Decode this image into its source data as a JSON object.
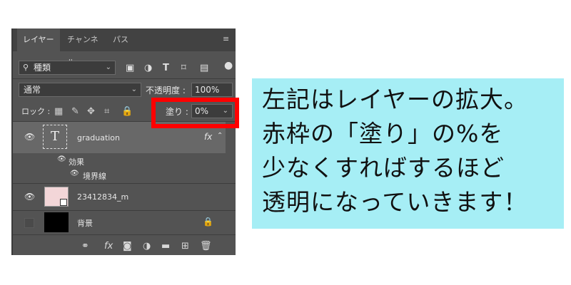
{
  "tabs": [
    {
      "label": "レイヤー",
      "active": true
    },
    {
      "label": "チャンネル",
      "active": false
    },
    {
      "label": "パス",
      "active": false
    }
  ],
  "panel_menu_icon": "hamburger-menu-icon",
  "filter": {
    "value": "種類"
  },
  "blend_mode": {
    "value": "通常"
  },
  "opacity": {
    "label": "不透明度 :",
    "value": "100%"
  },
  "lock": {
    "label": "ロック :"
  },
  "fill": {
    "label": "塗り :",
    "value": "0%"
  },
  "layers": [
    {
      "name": "graduation",
      "type": "text",
      "thumb_label": "T",
      "fx": "fx",
      "visible": true,
      "selected": true
    },
    {
      "name": "効果",
      "type": "effects-group"
    },
    {
      "name": "境界線",
      "type": "effect"
    },
    {
      "name": "23412834_m",
      "type": "image",
      "visible": true
    },
    {
      "name": "背景",
      "type": "background",
      "visible": false,
      "locked": true
    }
  ],
  "bottom_toolbar": {
    "fx": "fx"
  },
  "callout": {
    "lines": [
      "左記はレイヤーの拡大。",
      "赤枠の「塗り」の%を",
      "少なくすればするほど",
      "透明になっていきます！"
    ]
  },
  "colors": {
    "panel_bg": "#535353",
    "selected_row": "#686868",
    "callout_bg": "#a6eef5",
    "highlight": "#ff0000"
  }
}
